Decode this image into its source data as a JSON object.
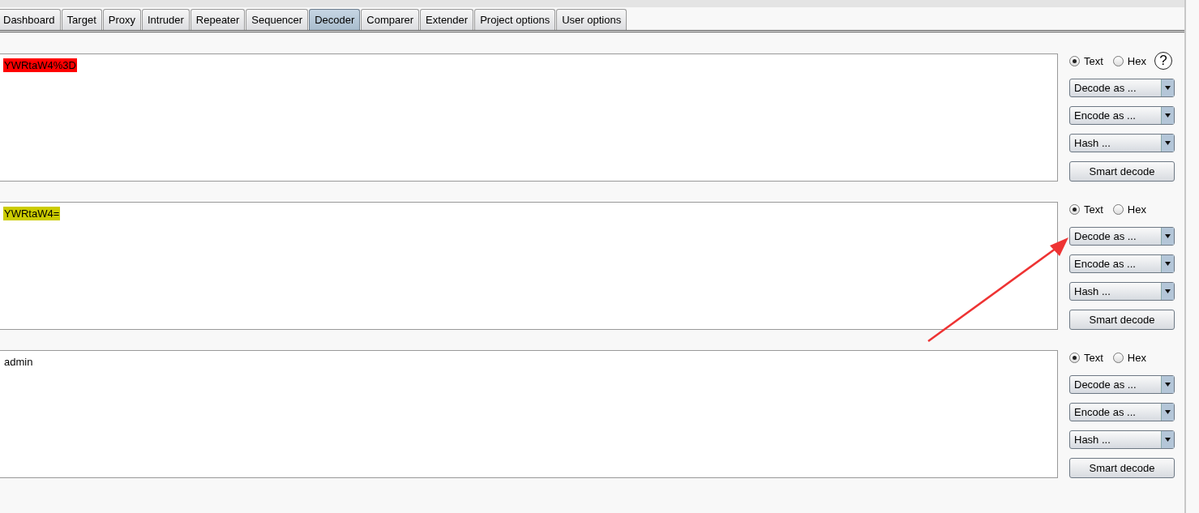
{
  "tabs": [
    {
      "label": "Dashboard",
      "selected": false
    },
    {
      "label": "Target",
      "selected": false
    },
    {
      "label": "Proxy",
      "selected": false
    },
    {
      "label": "Intruder",
      "selected": false
    },
    {
      "label": "Repeater",
      "selected": false
    },
    {
      "label": "Sequencer",
      "selected": false
    },
    {
      "label": "Decoder",
      "selected": true
    },
    {
      "label": "Comparer",
      "selected": false
    },
    {
      "label": "Extender",
      "selected": false
    },
    {
      "label": "Project options",
      "selected": false
    },
    {
      "label": "User options",
      "selected": false
    }
  ],
  "panels": [
    {
      "text": "YWRtaW4%3D",
      "color": "#ff0000",
      "modes": [
        {
          "label": "Text",
          "selected": true
        },
        {
          "label": "Hex",
          "selected": false
        }
      ],
      "help": "?",
      "dropdowns": [
        "Decode as ...",
        "Encode as ...",
        "Hash ..."
      ],
      "button": "Smart decode"
    },
    {
      "text": "YWRtaW4=",
      "color": "#cccc00",
      "modes": [
        {
          "label": "Text",
          "selected": true
        },
        {
          "label": "Hex",
          "selected": false
        }
      ],
      "dropdowns": [
        "Decode as ...",
        "Encode as ...",
        "Hash ..."
      ],
      "button": "Smart decode"
    },
    {
      "text": "admin",
      "modes": [
        {
          "label": "Text",
          "selected": true
        },
        {
          "label": "Hex",
          "selected": false
        }
      ],
      "dropdowns": [
        "Decode as ...",
        "Encode as ...",
        "Hash ..."
      ],
      "button": "Smart decode"
    }
  ]
}
